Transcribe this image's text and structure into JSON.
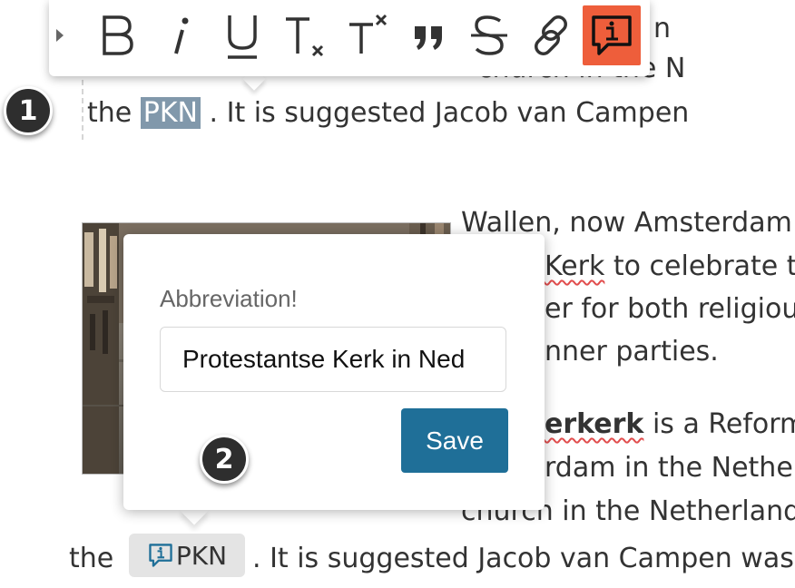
{
  "toolbar": {
    "buttons": [
      {
        "name": "bold",
        "label": "B",
        "icon": "bold-icon"
      },
      {
        "name": "italic",
        "label": "I",
        "icon": "italic-icon"
      },
      {
        "name": "underline",
        "label": "U",
        "icon": "underline-icon"
      },
      {
        "name": "subscript",
        "icon": "subscript-icon"
      },
      {
        "name": "superscript",
        "icon": "superscript-icon"
      },
      {
        "name": "blockquote",
        "icon": "blockquote-icon"
      },
      {
        "name": "strikethrough",
        "label": "S",
        "icon": "strikethrough-icon"
      },
      {
        "name": "link",
        "icon": "link-icon"
      },
      {
        "name": "abbreviation",
        "icon": "abbreviation-icon",
        "active": true
      }
    ],
    "active_color": "#ee5e3b"
  },
  "editor": {
    "line1": {
      "before": "the ",
      "selected": "PKN",
      "after": " . It is suggested Jacob van Campen"
    },
    "partial_top_right_1": "n",
    "partial_top_right_2": "church in the N",
    "bg_lines": [
      "Wallen, now Amsterdam",
      "Kerk to celebrate t",
      "er for both religiou",
      "nner parties.",
      "is a Reform",
      "rdam in the Nethe",
      "church in the Netherland"
    ],
    "bold_word": "erkerk",
    "bottom_line": {
      "before": "the",
      "abbr": "PKN",
      "after": ". It is suggested Jacob van Campen was"
    }
  },
  "markers": [
    "1",
    "2"
  ],
  "popup": {
    "label": "Abbreviation!",
    "input_value": "Protestantse Kerk in Ned",
    "save_label": "Save"
  },
  "colors": {
    "save_button": "#1f6f98",
    "selection_highlight": "#8198ab",
    "abbr_chip": "#e4e4e4"
  }
}
